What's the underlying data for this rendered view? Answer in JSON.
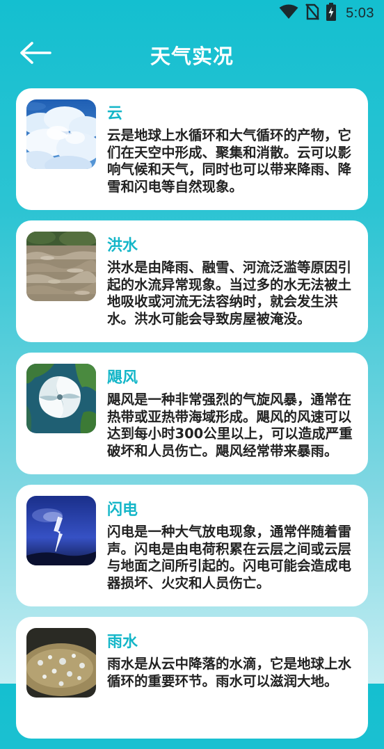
{
  "status_bar": {
    "time": "5:03",
    "icons": [
      "wifi-icon",
      "no-sim-icon",
      "battery-charging-icon"
    ]
  },
  "header": {
    "title": "天气实况",
    "back_icon": "arrow-left-icon"
  },
  "cards": [
    {
      "title": "云",
      "description": "云是地球上水循环和大气循环的产物，它们在天空中形成、聚集和消散。云可以影响气候和天气，同时也可以带来降雨、降雪和闪电等自然现象。",
      "image": "clouds-image"
    },
    {
      "title": "洪水",
      "description": "洪水是由降雨、融雪、河流泛滥等原因引起的水流异常现象。当过多的水无法被土地吸收或河流无法容纳时，就会发生洪水。洪水可能会导致房屋被淹没。",
      "image": "flood-image"
    },
    {
      "title": "飓风",
      "description": "飓风是一种非常强烈的气旋风暴，通常在热带或亚热带海域形成。飓风的风速可以达到每小时300公里以上，可以造成严重破坏和人员伤亡。飓风经常带来暴雨。",
      "image": "hurricane-image"
    },
    {
      "title": "闪电",
      "description": "闪电是一种大气放电现象，通常伴随着雷声。闪电是由电荷积累在云层之间或云层与地面之间所引起的。闪电可能会造成电器损坏、火灾和人员伤亡。",
      "image": "lightning-image"
    },
    {
      "title": "雨水",
      "description": "雨水是从云中降落的水滴，它是地球上水循环的重要环节。雨水可以滋润大地。",
      "image": "rain-image"
    }
  ]
}
